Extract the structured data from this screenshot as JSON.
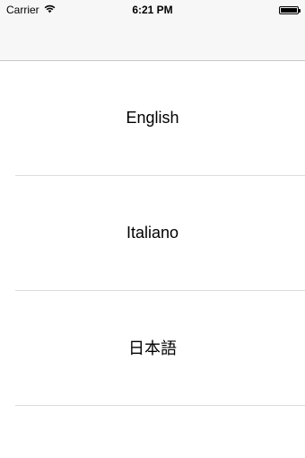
{
  "status_bar": {
    "carrier": "Carrier",
    "time": "6:21 PM",
    "wifi_icon": "wifi-icon",
    "battery_icon": "battery-icon",
    "battery_level": 1.0
  },
  "languages": {
    "items": [
      {
        "label": "English"
      },
      {
        "label": "Italiano"
      },
      {
        "label": "日本語"
      }
    ]
  },
  "colors": {
    "bar_background": "#f7f7f7",
    "separator": "#dcdcdf",
    "text": "#000000"
  }
}
